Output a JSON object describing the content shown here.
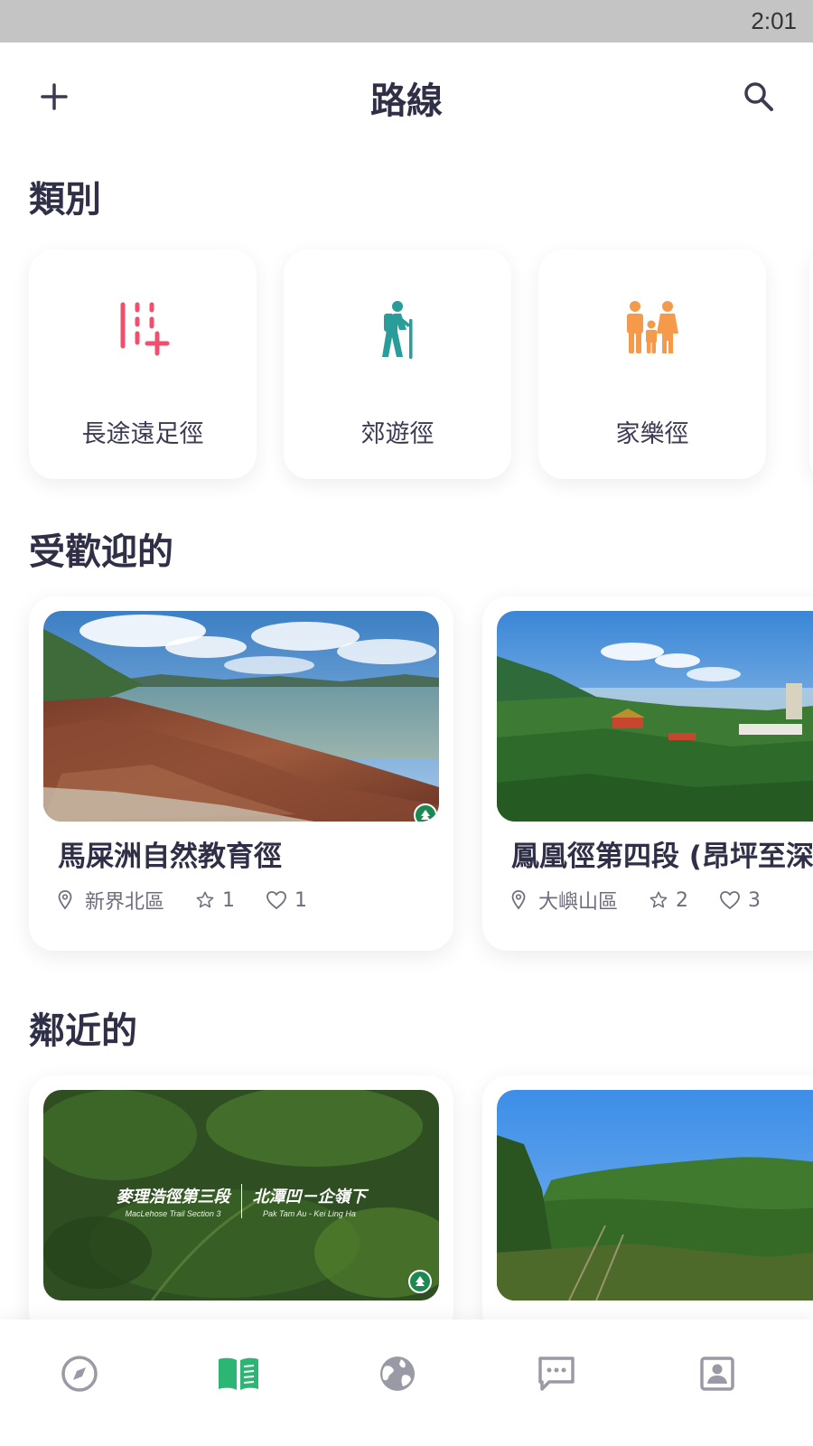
{
  "status_bar": {
    "time": "2:01"
  },
  "header": {
    "title": "路線",
    "add_icon": "plus-icon",
    "search_icon": "search-icon"
  },
  "categories": {
    "title": "類別",
    "items": [
      {
        "label": "長途遠足徑",
        "icon": "long-distance-trail-icon",
        "color": "#f0506e"
      },
      {
        "label": "郊遊徑",
        "icon": "hiker-icon",
        "color": "#2a9d9a"
      },
      {
        "label": "家樂徑",
        "icon": "family-icon",
        "color": "#f59a4a"
      }
    ]
  },
  "popular": {
    "title": "受歡迎的",
    "items": [
      {
        "name": "馬屎洲自然教育徑",
        "region": "新界北區",
        "rating": "1",
        "likes": "1"
      },
      {
        "name": "鳳凰徑第四段 (昂坪至深",
        "region": "大嶼山區",
        "rating": "2",
        "likes": "3"
      }
    ]
  },
  "nearby": {
    "title": "鄰近的",
    "items": [
      {
        "overlay_title_left": "麥理浩徑第三段",
        "overlay_title_right": "北潭凹－企嶺下",
        "overlay_sub_left": "MacLehose Trail Section 3",
        "overlay_sub_right": "Pak Tam Au - Kei Ling Ha"
      },
      {}
    ]
  },
  "bottom_nav": {
    "items": [
      {
        "icon": "compass-icon",
        "active": false
      },
      {
        "icon": "book-icon",
        "active": true
      },
      {
        "icon": "globe-icon",
        "active": false
      },
      {
        "icon": "chat-icon",
        "active": false
      },
      {
        "icon": "profile-icon",
        "active": false
      }
    ],
    "active_color": "#2bb673",
    "inactive_color": "#9a9aa6"
  }
}
